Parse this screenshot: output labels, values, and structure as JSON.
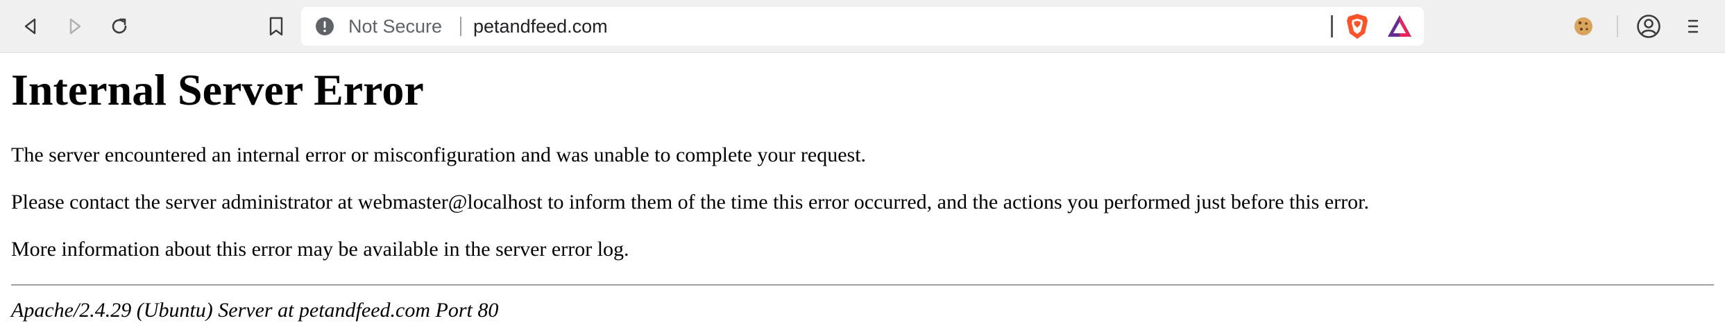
{
  "browser": {
    "security_label": "Not Secure",
    "url": "petandfeed.com",
    "icons": {
      "back": "back-arrow-icon",
      "forward": "forward-arrow-icon",
      "reload": "reload-icon",
      "bookmark": "bookmark-icon",
      "security": "info-warning-icon",
      "shield": "brave-shield-icon",
      "rewards": "brave-rewards-icon",
      "cookie": "cookie-extension-icon",
      "profile": "profile-icon",
      "menu": "menu-icon"
    },
    "colors": {
      "toolbar_bg": "#f0f0f1",
      "brave_orange": "#fb542b",
      "rewards_purple": "#662d91"
    }
  },
  "page": {
    "title": "Internal Server Error",
    "paragraphs": [
      "The server encountered an internal error or misconfiguration and was unable to complete your request.",
      "Please contact the server administrator at webmaster@localhost to inform them of the time this error occurred, and the actions you performed just before this error.",
      "More information about this error may be available in the server error log."
    ],
    "server_signature": "Apache/2.4.29 (Ubuntu) Server at petandfeed.com Port 80"
  }
}
